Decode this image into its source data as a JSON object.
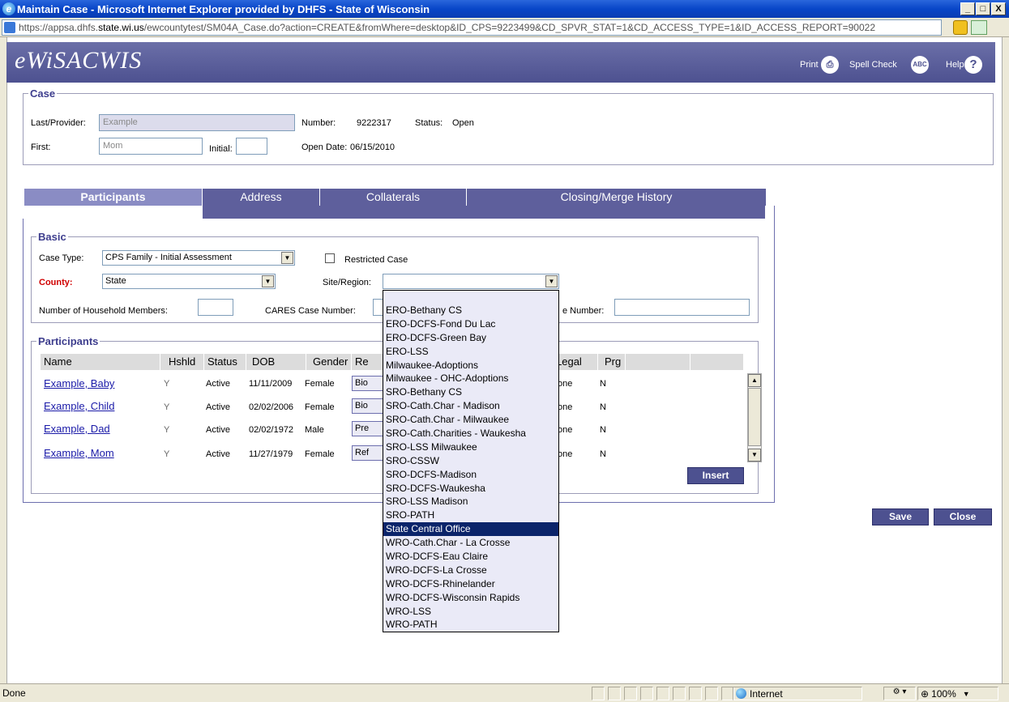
{
  "window": {
    "title": "Maintain Case - Microsoft Internet Explorer provided by DHFS - State of Wisconsin",
    "min": "_",
    "max": "□",
    "close": "X"
  },
  "address": {
    "prefix": "https://appsa.dhfs.",
    "domain": "state.wi.us",
    "path": "/ewcountytest/SM04A_Case.do?action=CREATE&fromWhere=desktop&ID_CPS=9223499&CD_SPVR_STAT=1&CD_ACCESS_TYPE=1&ID_ACCESS_REPORT=90022"
  },
  "header": {
    "logo": "eWiSACWIS",
    "print": "Print",
    "spell_check": "Spell Check",
    "help": "Help",
    "help_glyph": "?",
    "print_glyph": "⎙",
    "spell_glyph": "ABC"
  },
  "case": {
    "legend": "Case",
    "last_label": "Last/Provider:",
    "last_value": "Example",
    "first_label": "First:",
    "first_value": "Mom",
    "initial_label": "Initial:",
    "initial_value": "",
    "number_label": "Number:",
    "number_value": "9222317",
    "status_label": "Status:",
    "status_value": "Open",
    "open_date_label": "Open Date:",
    "open_date_value": "06/15/2010"
  },
  "tabs": [
    "Participants",
    "Address",
    "Collaterals",
    "Closing/Merge History"
  ],
  "basic": {
    "legend": "Basic",
    "case_type_label": "Case Type:",
    "case_type_value": "CPS Family - Initial Assessment",
    "restricted_label": "Restricted Case",
    "county_label": "County:",
    "county_value": "State",
    "site_label": "Site/Region:",
    "site_value": "",
    "household_label": "Number of Household Members:",
    "cares_label": "CARES Case Number:",
    "other_number_label": "e Number:"
  },
  "participants": {
    "legend": "Participants",
    "columns": [
      "Name",
      "Hshld",
      "Status",
      "DOB",
      "Gender",
      "Re",
      "Legal",
      "Prg"
    ],
    "rows": [
      {
        "name": "Example, Baby",
        "hshld": "Y",
        "status": "Active",
        "dob": "11/11/2009",
        "gender": "Female",
        "rel": "Bio",
        "legal": "one",
        "prg": "N"
      },
      {
        "name": "Example, Child",
        "hshld": "Y",
        "status": "Active",
        "dob": "02/02/2006",
        "gender": "Female",
        "rel": "Bio",
        "legal": "one",
        "prg": "N"
      },
      {
        "name": "Example, Dad",
        "hshld": "Y",
        "status": "Active",
        "dob": "02/02/1972",
        "gender": "Male",
        "rel": "Pre",
        "legal": "one",
        "prg": "N"
      },
      {
        "name": "Example, Mom",
        "hshld": "Y",
        "status": "Active",
        "dob": "11/27/1979",
        "gender": "Female",
        "rel": "Ref",
        "legal": "one",
        "prg": "N"
      }
    ],
    "insert": "Insert"
  },
  "dropdown": {
    "options": [
      "ERO-Bethany CS",
      "ERO-DCFS-Fond Du Lac",
      "ERO-DCFS-Green Bay",
      "ERO-LSS",
      "Milwaukee-Adoptions",
      "Milwaukee - OHC-Adoptions",
      "SRO-Bethany CS",
      "SRO-Cath.Char - Madison",
      "SRO-Cath.Char - Milwaukee",
      "SRO-Cath.Charities - Waukesha",
      "SRO-LSS Milwaukee",
      "SRO-CSSW",
      "SRO-DCFS-Madison",
      "SRO-DCFS-Waukesha",
      "SRO-LSS Madison",
      "SRO-PATH",
      "State Central Office",
      "WRO-Cath.Char - La Crosse",
      "WRO-DCFS-Eau Claire",
      "WRO-DCFS-La Crosse",
      "WRO-DCFS-Rhinelander",
      "WRO-DCFS-Wisconsin Rapids",
      "WRO-LSS",
      "WRO-PATH"
    ],
    "highlighted": "State Central Office"
  },
  "actions": {
    "save": "Save",
    "close": "Close"
  },
  "status": {
    "left": "Done",
    "zone": "Internet",
    "zoom": "100%"
  }
}
